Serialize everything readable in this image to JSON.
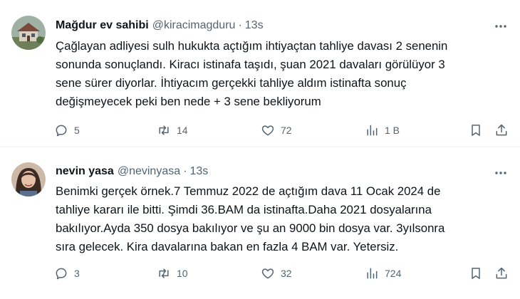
{
  "tweets": [
    {
      "author_name": "Mağdur ev sahibi",
      "author_handle": "@kiracimagduru",
      "separator": "·",
      "time": "13s",
      "lines": [
        "Çağlayan adliyesi sulh hukukta açtığım ihtiyaçtan tahliye davası 2 senenin",
        "sonunda sonuçlandı. Kiracı istinafa taşıdı, şuan 2021 davaları görülüyor 3",
        "sene sürer diyorlar. İhtiyacım gerçekki tahliye aldım istinafta sonuç",
        "değişmeyecek peki ben nede + 3 sene bekliyorum"
      ],
      "replies": "5",
      "retweets": "14",
      "likes": "72",
      "views": "1 B"
    },
    {
      "author_name": "nevin yasa",
      "author_handle": "@nevinyasa",
      "separator": "·",
      "time": "13s",
      "lines": [
        "Benimki gerçek örnek.7 Temmuz 2022 de açtığım dava 11 Ocak 2024 de",
        "tahliye kararı ile bitti. Şimdi 36.BAM da istinafta.Daha 2021 dosyalarına",
        "bakılıyor.Ayda 350 dosya bakılıyor ve şu an 9000 bin dosya var. 3yılsonra",
        "sıra gelecek. Kira davalarına bakan en fazla 4 BAM var. Yetersiz."
      ],
      "replies": "3",
      "retweets": "10",
      "likes": "32",
      "views": "724"
    }
  ],
  "icons": {
    "reply": "reply-icon",
    "retweet": "retweet-icon",
    "like": "heart-icon",
    "views": "views-icon",
    "bookmark": "bookmark-icon",
    "share": "share-icon",
    "more": "more-icon"
  },
  "colors": {
    "text": "#0f1419",
    "secondary": "#536471",
    "divider": "#eff3f4"
  }
}
